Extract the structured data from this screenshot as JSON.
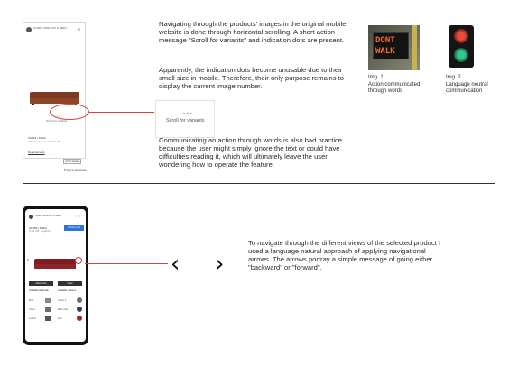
{
  "top_section": {
    "phone": {
      "brand": "CHRIS MINIATO & WEN",
      "menu_icon": "≡",
      "dots": "• • •",
      "scroll_label": "Scroll for variants",
      "product_title": "CH101 | SOFA",
      "product_desc": "This product costs: Put 187",
      "requirements_link": "Requirements",
      "find_button": "Find dealer",
      "favourite_label": "♥ Add to favourites"
    },
    "zoom": {
      "dots": "• • •",
      "label": "Scroll for variants"
    },
    "paragraph_1": "Navigating through the products' images in the original mobile website is done through horizontal scrolling. A short action message \"Scroll for variants\" and indication dots are present.",
    "paragraph_2": "Apparently, the indication dots become unusable due to their small size in mobile. Therefore, their only purpose remains to display the current image number.",
    "paragraph_3": "Communicating an action through words is also bad practice because the user might simply ignore the text or could have difficulties reading it, which will ultimately leave the user wondering how to operate the feature.",
    "figures": [
      {
        "label": "Img. 1",
        "caption": "Action communicated through words",
        "sign_line_1": "DONT",
        "sign_line_2": "WALK"
      },
      {
        "label": "Img. 2",
        "caption": "Language neutral communication"
      }
    ]
  },
  "bottom_section": {
    "phone": {
      "brand": "CHRIS MINIATO & WEN",
      "header_icons": "♡ ≡",
      "product_title": "CH163 | SOFA",
      "product_sub": "Kr 12 345 · Paganini",
      "cta_label": "Show in AR",
      "arrow_left": "‹",
      "arrow_right": "›",
      "button_left": "Add to Cart",
      "button_right": "Order",
      "materials_heading": "Available Materials",
      "colours_heading": "Available Colours",
      "material_rows": [
        "Wool",
        "Velvet",
        "Leather"
      ],
      "colour_rows": [
        "Colour A",
        "Black Oak",
        "Red"
      ],
      "colour_dots": [
        "#5f6f80",
        "#3c3c58",
        "#a02427"
      ]
    },
    "arrow_back": "‹",
    "arrow_forward": "›",
    "paragraph_4": "To navigate through the different views of the selected product I used a language natural approach of applying navigational arrows. The arrows portray a simple message of going either \"backward\" or \"forward\"."
  }
}
